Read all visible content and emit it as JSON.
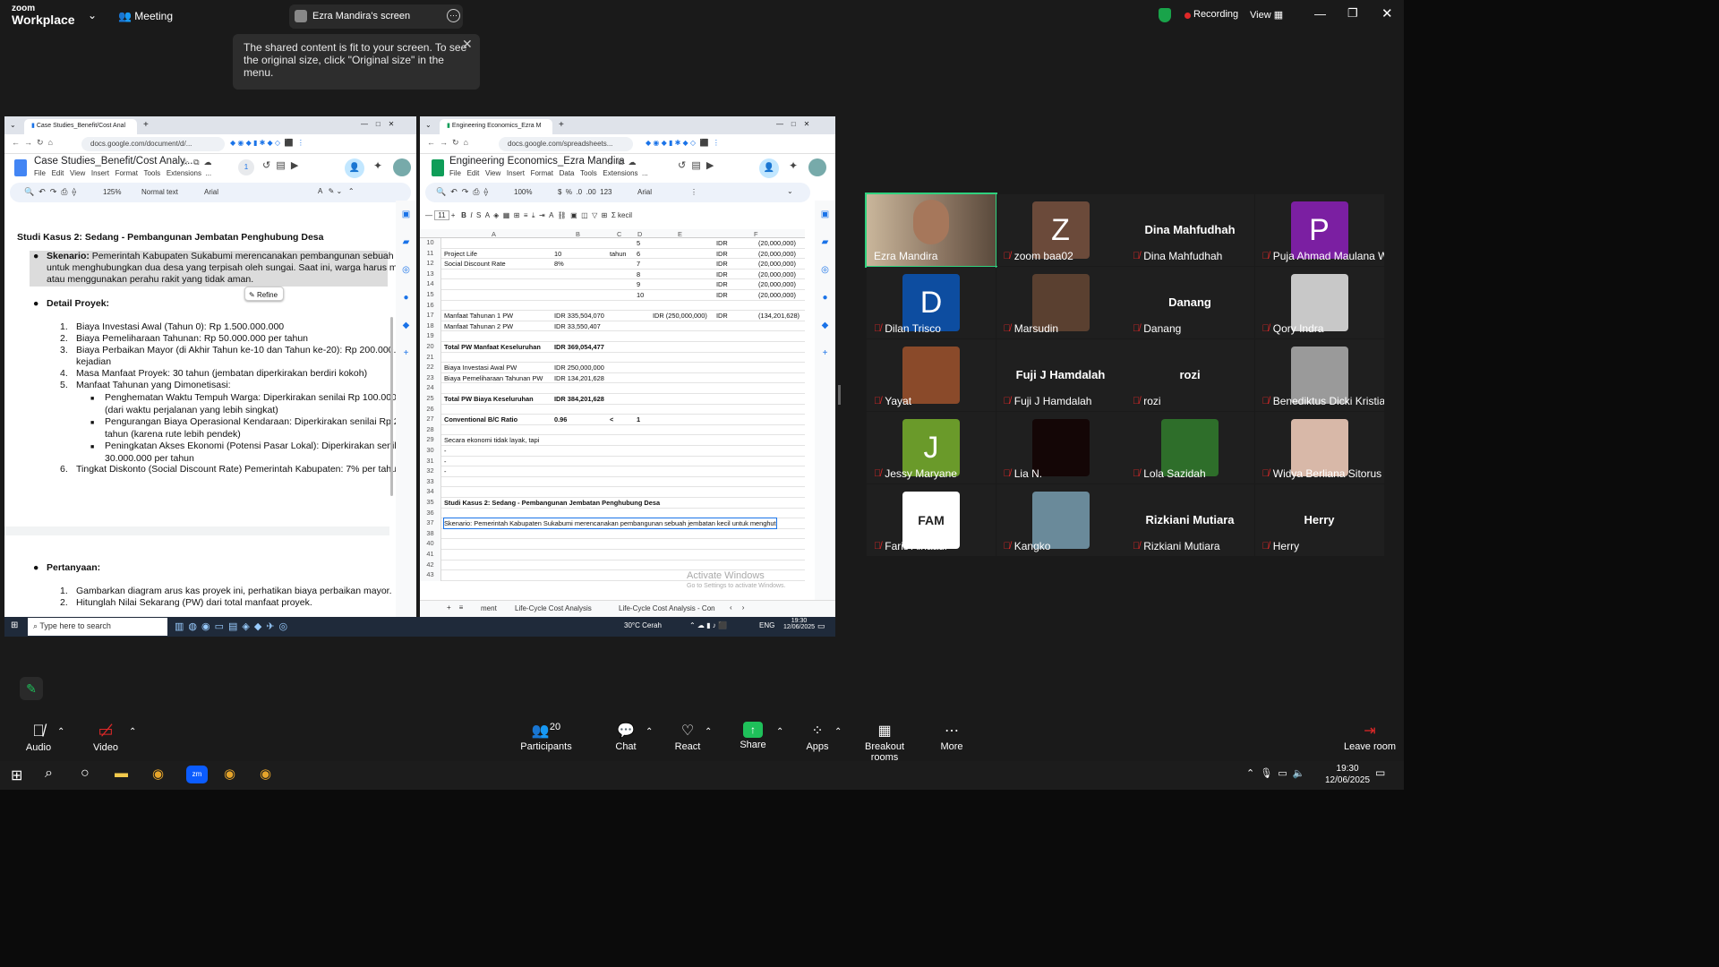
{
  "zoom": {
    "brand_top": "zoom",
    "brand": "Workplace",
    "meeting_label": "Meeting",
    "screen_owner": "Ezra Mandira's screen",
    "recording": "Recording",
    "view": "View",
    "tooltip": "The shared content is fit to your screen. To see the original size, click \"Original size\" in the menu."
  },
  "doc": {
    "tab_title": "Case Studies_Benefit/Cost Anal",
    "url": "docs.google.com/document/d/...",
    "title": "Case Studies_Benefit/Cost Analy...",
    "menu": [
      "File",
      "Edit",
      "View",
      "Insert",
      "Format",
      "Tools",
      "Extensions",
      "..."
    ],
    "zoom": "125%",
    "style": "Normal text",
    "font": "Arial",
    "heading": "Studi Kasus 2: Sedang - Pembangunan Jembatan Penghubung Desa",
    "scenario_label": "Skenario:",
    "scenario_lines": [
      "Pemerintah Kabupaten Sukabumi merencanakan pembangunan sebuah je",
      "untuk menghubungkan dua desa yang terpisah oleh sungai. Saat ini, warga harus me",
      "atau menggunakan perahu rakit yang tidak aman."
    ],
    "refine": "Refine",
    "detail_label": "Detail Proyek:",
    "items": [
      {
        "n": "1.",
        "t": "Biaya Investasi Awal (Tahun 0): Rp 1.500.000.000"
      },
      {
        "n": "2.",
        "t": "Biaya Pemeliharaan Tahunan: Rp 50.000.000 per tahun"
      },
      {
        "n": "3.",
        "t": "Biaya Perbaikan Mayor (di Akhir Tahun ke-10 dan Tahun ke-20): Rp 200.000.0"
      },
      {
        "n": "",
        "t": "kejadian"
      },
      {
        "n": "4.",
        "t": "Masa Manfaat Proyek: 30 tahun (jembatan diperkirakan berdiri kokoh)"
      },
      {
        "n": "5.",
        "t": "Manfaat Tahunan yang Dimonetisasi:"
      }
    ],
    "sub_items": [
      "Penghematan Waktu Tempuh Warga: Diperkirakan senilai Rp 100.000.",
      "(dari waktu perjalanan yang lebih singkat)",
      "Pengurangan Biaya Operasional Kendaraan: Diperkirakan senilai Rp 2",
      "tahun (karena rute lebih pendek)",
      "Peningkatan Akses Ekonomi (Potensi Pasar Lokal): Diperkirakan senila",
      "30.000.000 per tahun"
    ],
    "item6": "Tingkat Diskonto (Social Discount Rate) Pemerintah Kabupaten: 7% per tahun",
    "question_label": "Pertanyaan:",
    "questions": [
      {
        "n": "1.",
        "t": "Gambarkan diagram arus kas proyek ini, perhatikan biaya perbaikan mayor."
      },
      {
        "n": "2.",
        "t": "Hitunglah Nilai Sekarang (PW) dari total manfaat proyek."
      }
    ]
  },
  "sheet": {
    "tab_title": "Engineering Economics_Ezra M",
    "url": "docs.google.com/spreadsheets...",
    "title": "Engineering Economics_Ezra Mandira",
    "menu": [
      "File",
      "Edit",
      "View",
      "Insert",
      "Format",
      "Data",
      "Tools",
      "Extensions",
      "..."
    ],
    "zoom": "100%",
    "font": "Arial",
    "font_size": "11",
    "cols": [
      "A",
      "B",
      "C",
      "D",
      "E",
      "F"
    ],
    "rows": [
      {
        "r": "10",
        "a": "",
        "b": "",
        "c": "",
        "d": "5",
        "e": "",
        "f1": "IDR",
        "f": "(20,000,000)"
      },
      {
        "r": "11",
        "a": "Project Life",
        "b": "10",
        "c": "tahun",
        "d": "6",
        "e": "",
        "f1": "IDR",
        "f": "(20,000,000)"
      },
      {
        "r": "12",
        "a": "Social Discount Rate",
        "b": "8%",
        "c": "",
        "d": "7",
        "e": "",
        "f1": "IDR",
        "f": "(20,000,000)"
      },
      {
        "r": "13",
        "a": "",
        "b": "",
        "c": "",
        "d": "8",
        "e": "",
        "f1": "IDR",
        "f": "(20,000,000)"
      },
      {
        "r": "14",
        "a": "",
        "b": "",
        "c": "",
        "d": "9",
        "e": "",
        "f1": "IDR",
        "f": "(20,000,000)"
      },
      {
        "r": "15",
        "a": "",
        "b": "",
        "c": "",
        "d": "10",
        "e": "",
        "f1": "IDR",
        "f": "(20,000,000)"
      },
      {
        "r": "16",
        "a": "",
        "b": "",
        "c": "",
        "d": "",
        "e": "",
        "f1": "",
        "f": ""
      },
      {
        "r": "17",
        "a": "Manfaat Tahunan 1 PW",
        "b": "IDR 335,504,070",
        "c": "",
        "d": "",
        "e": "IDR   (250,000,000)",
        "f1": "IDR",
        "f": "(134,201,628)"
      },
      {
        "r": "18",
        "a": "Manfaat Tahunan 2 PW",
        "b": "IDR   33,550,407",
        "c": "",
        "d": "",
        "e": "",
        "f1": "",
        "f": ""
      },
      {
        "r": "19",
        "a": "",
        "b": "",
        "c": "",
        "d": "",
        "e": "",
        "f1": "",
        "f": ""
      },
      {
        "r": "20",
        "a": "Total PW Manfaat Keseluruhan",
        "b": "IDR 369,054,477",
        "c": "",
        "d": "",
        "e": "",
        "f1": "",
        "f": "",
        "bold": true
      },
      {
        "r": "21",
        "a": "",
        "b": "",
        "c": "",
        "d": "",
        "e": "",
        "f1": "",
        "f": ""
      },
      {
        "r": "22",
        "a": "Biaya Investasi Awal PW",
        "b": "IDR 250,000,000",
        "c": "",
        "d": "",
        "e": "",
        "f1": "",
        "f": ""
      },
      {
        "r": "23",
        "a": "Biaya Pemeliharaan Tahunan PW",
        "b": "IDR 134,201,628",
        "c": "",
        "d": "",
        "e": "",
        "f1": "",
        "f": ""
      },
      {
        "r": "24",
        "a": "",
        "b": "",
        "c": "",
        "d": "",
        "e": "",
        "f1": "",
        "f": ""
      },
      {
        "r": "25",
        "a": "Total PW Biaya Keseluruhan",
        "b": "IDR 384,201,628",
        "c": "",
        "d": "",
        "e": "",
        "f1": "",
        "f": "",
        "bold": true
      },
      {
        "r": "26",
        "a": "",
        "b": "",
        "c": "",
        "d": "",
        "e": "",
        "f1": "",
        "f": ""
      },
      {
        "r": "27",
        "a": "Conventional B/C Ratio",
        "b": "0.96",
        "c": "<",
        "d": "1",
        "e": "",
        "f1": "",
        "f": "",
        "bold": true
      },
      {
        "r": "28",
        "a": "",
        "b": "",
        "c": "",
        "d": "",
        "e": "",
        "f1": "",
        "f": ""
      },
      {
        "r": "29",
        "a": "Secara ekonomi tidak layak, tapi",
        "b": "",
        "c": "",
        "d": "",
        "e": "",
        "f1": "",
        "f": ""
      },
      {
        "r": "30",
        "a": "-",
        "b": "",
        "c": "",
        "d": "",
        "e": "",
        "f1": "",
        "f": ""
      },
      {
        "r": "31",
        "a": "-",
        "b": "",
        "c": "",
        "d": "",
        "e": "",
        "f1": "",
        "f": ""
      },
      {
        "r": "32",
        "a": "-",
        "b": "",
        "c": "",
        "d": "",
        "e": "",
        "f1": "",
        "f": ""
      },
      {
        "r": "33",
        "a": "",
        "b": "",
        "c": "",
        "d": "",
        "e": "",
        "f1": "",
        "f": ""
      },
      {
        "r": "34",
        "a": "",
        "b": "",
        "c": "",
        "d": "",
        "e": "",
        "f1": "",
        "f": ""
      },
      {
        "r": "35",
        "a": "Studi Kasus 2: Sedang - Pembangunan Jembatan Penghubung Desa",
        "b": "",
        "c": "",
        "d": "",
        "e": "",
        "f1": "",
        "f": "",
        "bold": true
      },
      {
        "r": "36",
        "a": "",
        "b": "",
        "c": "",
        "d": "",
        "e": "",
        "f1": "",
        "f": ""
      },
      {
        "r": "37",
        "a": "Skenario: Pemerintah Kabupaten Sukabumi merencanakan pembangunan sebuah jembatan kecil untuk menghut",
        "b": "",
        "c": "",
        "d": "",
        "e": "",
        "f1": "",
        "f": "",
        "sel": true
      },
      {
        "r": "38",
        "a": "",
        "b": "",
        "c": "",
        "d": "",
        "e": "",
        "f1": "",
        "f": ""
      },
      {
        "r": "40",
        "a": "",
        "b": "",
        "c": "",
        "d": "",
        "e": "",
        "f1": "",
        "f": ""
      },
      {
        "r": "41",
        "a": "",
        "b": "",
        "c": "",
        "d": "",
        "e": "",
        "f1": "",
        "f": ""
      },
      {
        "r": "42",
        "a": "",
        "b": "",
        "c": "",
        "d": "",
        "e": "",
        "f1": "",
        "f": ""
      },
      {
        "r": "43",
        "a": "",
        "b": "",
        "c": "",
        "d": "",
        "e": "",
        "f1": "",
        "f": ""
      }
    ],
    "activate1": "Activate Windows",
    "activate2": "Go to Settings to activate Windows.",
    "sheet_tabs": [
      "ment",
      "Life-Cycle Cost Analysis",
      "Life-Cycle Cost Analysis - Con"
    ]
  },
  "shared_taskbar": {
    "search": "Type here to search",
    "weather": "30°C  Cerah",
    "lang": "ENG",
    "time": "19:30",
    "date": "12/06/2025"
  },
  "participants": [
    {
      "name": "Ezra Mandira",
      "type": "video",
      "active": true,
      "muted": false
    },
    {
      "name": "zoom baa02",
      "type": "letter",
      "letter": "Z",
      "color": "#6b4a3a",
      "muted": true
    },
    {
      "name": "Dina Mahfudhah",
      "type": "text",
      "muted": true
    },
    {
      "name": "Puja Ahmad Maulana W...",
      "type": "letter",
      "letter": "P",
      "color": "#7b1fa2",
      "muted": true
    },
    {
      "name": "Dilan Trisco",
      "type": "letter",
      "letter": "D",
      "color": "#0d4da0",
      "muted": true
    },
    {
      "name": "Marsudin",
      "type": "photo",
      "color": "#5a4030",
      "muted": true
    },
    {
      "name": "Danang",
      "type": "text",
      "muted": true
    },
    {
      "name": "Qory Indra",
      "type": "photo",
      "color": "#c8c8c8",
      "muted": true
    },
    {
      "name": "Yayat",
      "type": "photo",
      "color": "#8a4a2a",
      "muted": true
    },
    {
      "name": "Fuji J Hamdalah",
      "type": "text",
      "muted": true
    },
    {
      "name": "rozi",
      "type": "text",
      "muted": true
    },
    {
      "name": "Benediktus Dicki Kristian",
      "type": "photo",
      "color": "#9a9a9a",
      "muted": true
    },
    {
      "name": "Jessy Maryane",
      "type": "letter",
      "letter": "J",
      "color": "#6a9a2a",
      "muted": true
    },
    {
      "name": "Lia N.",
      "type": "photo",
      "color": "#140606",
      "muted": true
    },
    {
      "name": "Lola Sazidah",
      "type": "photo",
      "color": "#2e6e2a",
      "muted": true
    },
    {
      "name": "Widya Berliana Sitorus",
      "type": "photo",
      "color": "#d8b8a8",
      "muted": true
    },
    {
      "name": "Faris Alhaadi",
      "type": "letter",
      "letter": "FAM",
      "color": "#ffffff",
      "muted": true
    },
    {
      "name": "Kangko",
      "type": "photo",
      "color": "#6a8a9a",
      "muted": true
    },
    {
      "name": "Rizkiani Mutiara",
      "type": "text",
      "muted": true
    },
    {
      "name": "Herry",
      "type": "text",
      "muted": true
    }
  ],
  "controls": {
    "audio": "Audio",
    "video": "Video",
    "participants": "Participants",
    "participants_count": "20",
    "chat": "Chat",
    "react": "React",
    "share": "Share",
    "apps": "Apps",
    "breakout": "Breakout rooms",
    "more": "More",
    "leave": "Leave room"
  },
  "os_taskbar": {
    "time": "19:30",
    "date": "12/06/2025"
  }
}
